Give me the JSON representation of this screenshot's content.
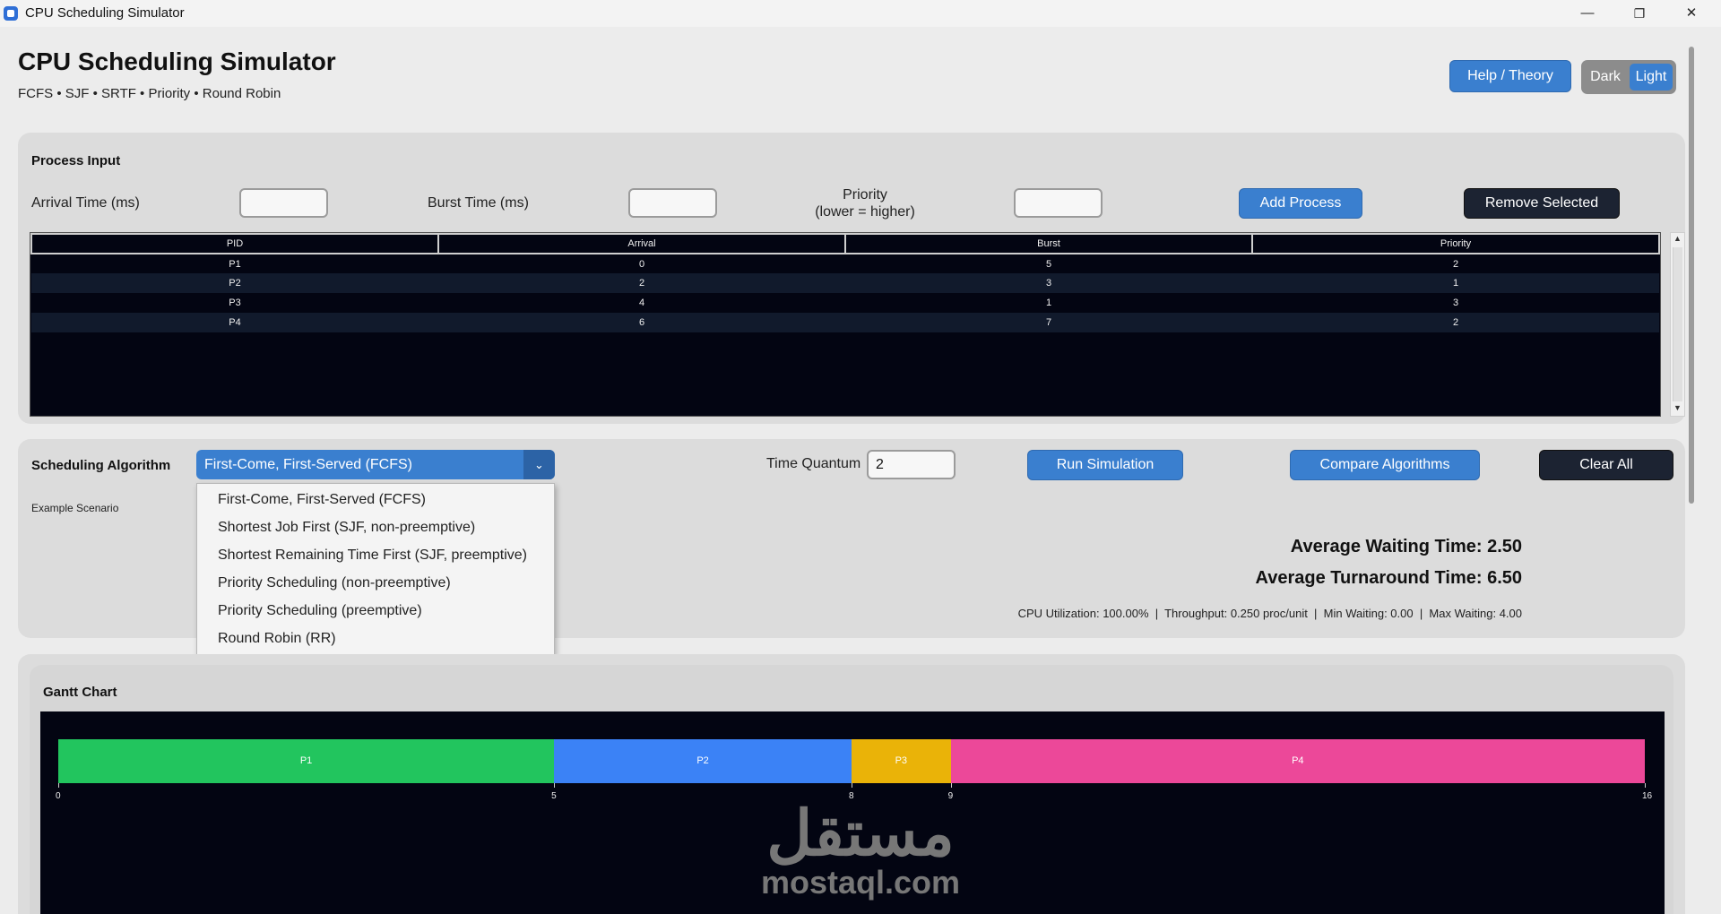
{
  "window": {
    "title": "CPU Scheduling Simulator",
    "minimize_glyph": "—",
    "restore_glyph": "❐",
    "close_glyph": "✕"
  },
  "header": {
    "title": "CPU Scheduling Simulator",
    "subtitle": "FCFS • SJF • SRTF • Priority • Round Robin",
    "help_label": "Help / Theory",
    "theme_dark": "Dark",
    "theme_light": "Light",
    "active_theme": "Light"
  },
  "process_input": {
    "title": "Process Input",
    "arrival_label": "Arrival Time (ms)",
    "arrival_value": "",
    "burst_label": "Burst Time (ms)",
    "burst_value": "",
    "priority_label_line1": "Priority",
    "priority_label_line2": "(lower = higher)",
    "priority_value": "",
    "add_label": "Add Process",
    "remove_label": "Remove Selected",
    "table": {
      "columns": [
        "PID",
        "Arrival",
        "Burst",
        "Priority"
      ],
      "rows": [
        [
          "P1",
          "0",
          "5",
          "2"
        ],
        [
          "P2",
          "2",
          "3",
          "1"
        ],
        [
          "P3",
          "4",
          "1",
          "3"
        ],
        [
          "P4",
          "6",
          "7",
          "2"
        ]
      ]
    }
  },
  "algorithm": {
    "title": "Scheduling Algorithm",
    "selected": "First-Come, First-Served (FCFS)",
    "example_label": "Example Scenario",
    "options": [
      "First-Come, First-Served (FCFS)",
      "Shortest Job First (SJF, non-preemptive)",
      "Shortest Remaining Time First (SJF, preemptive)",
      "Priority Scheduling (non-preemptive)",
      "Priority Scheduling (preemptive)",
      "Round Robin (RR)"
    ],
    "quantum_label": "Time Quantum",
    "quantum_value": "2",
    "run_label": "Run Simulation",
    "compare_label": "Compare Algorithms",
    "clear_label": "Clear All"
  },
  "results": {
    "avg_waiting": "Average Waiting Time: 2.50",
    "avg_turnaround": "Average Turnaround Time: 6.50",
    "details": "CPU Utilization: 100.00%  |  Throughput: 0.250 proc/unit  |  Min Waiting: 0.00  |  Max Waiting: 4.00"
  },
  "gantt": {
    "title": "Gantt Chart",
    "total_time": 16,
    "segments": [
      {
        "pid": "P1",
        "start": 0,
        "end": 5,
        "color": "#22c55e"
      },
      {
        "pid": "P2",
        "start": 5,
        "end": 8,
        "color": "#3b82f6"
      },
      {
        "pid": "P3",
        "start": 8,
        "end": 9,
        "color": "#eab308"
      },
      {
        "pid": "P4",
        "start": 9,
        "end": 16,
        "color": "#ec4899"
      }
    ],
    "ticks": [
      "0",
      "5",
      "8",
      "9",
      "16"
    ]
  },
  "watermark": {
    "arabic": "مستقل",
    "latin": "mostaql.com"
  }
}
